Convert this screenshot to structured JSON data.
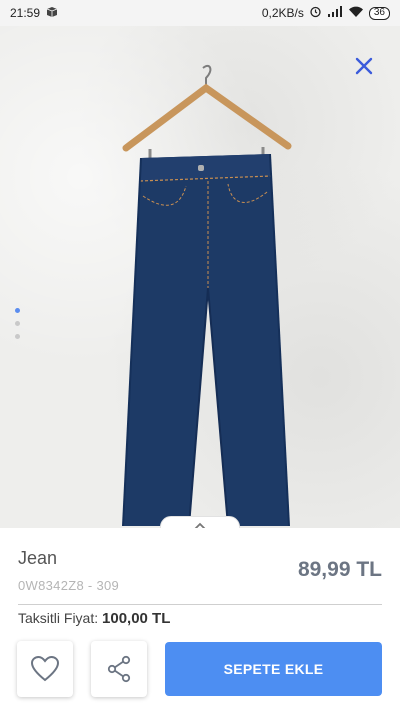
{
  "status_bar": {
    "time": "21:59",
    "network_speed": "0,2KB/s",
    "battery": "36"
  },
  "product": {
    "name": "Jean",
    "code": "0W8342Z8 - 309",
    "price": "89,99 TL",
    "installment_label": "Taksitli Fiyat:",
    "installment_price": "100,00 TL"
  },
  "gallery": {
    "image_count": 3,
    "active_index": 0
  },
  "actions": {
    "add_to_cart_label": "SEPETE EKLE"
  },
  "icons": {
    "close": "close-icon",
    "favorite": "heart-icon",
    "share": "share-icon",
    "expand": "chevron-up-icon"
  },
  "colors": {
    "accent": "#4d8ef2",
    "price": "#6c7583",
    "close_icon": "#3b5bdb",
    "denim": "#1d3a66"
  }
}
